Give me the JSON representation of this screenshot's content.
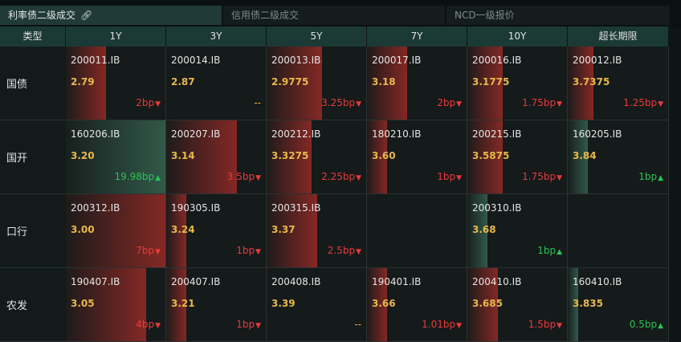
{
  "tabs": [
    {
      "label": "利率债二级成交",
      "active": true,
      "icon": "link-icon"
    },
    {
      "label": "信用债二级成交",
      "active": false
    },
    {
      "label": "NCD一级报价",
      "active": false
    }
  ],
  "header": {
    "type_label": "类型",
    "columns": [
      "1Y",
      "3Y",
      "5Y",
      "7Y",
      "10Y",
      "超长期限"
    ]
  },
  "colors": {
    "up": "#e93a3a",
    "down": "#29c553",
    "yield": "#e8b94a",
    "header_bg": "#1b3a36"
  },
  "rows": [
    {
      "label": "国债",
      "cells": [
        {
          "code": "200011.IB",
          "yield": "2.79",
          "change": "2bp",
          "dir": "up",
          "level": 0.4
        },
        {
          "code": "200014.IB",
          "yield": "2.87",
          "change": "--",
          "dir": "none",
          "level": 0
        },
        {
          "code": "200013.IB",
          "yield": "2.9775",
          "change": "3.25bp",
          "dir": "up",
          "level": 0.55
        },
        {
          "code": "200017.IB",
          "yield": "3.18",
          "change": "2bp",
          "dir": "up",
          "level": 0.4
        },
        {
          "code": "200016.IB",
          "yield": "3.1775",
          "change": "1.75bp",
          "dir": "up",
          "level": 0.35
        },
        {
          "code": "200012.IB",
          "yield": "3.7375",
          "change": "1.25bp",
          "dir": "up",
          "level": 0.25
        }
      ]
    },
    {
      "label": "国开",
      "cells": [
        {
          "code": "160206.IB",
          "yield": "3.20",
          "change": "19.98bp",
          "dir": "down",
          "level": 1.0
        },
        {
          "code": "200207.IB",
          "yield": "3.14",
          "change": "3.5bp",
          "dir": "up",
          "level": 0.7
        },
        {
          "code": "200212.IB",
          "yield": "3.3275",
          "change": "2.25bp",
          "dir": "up",
          "level": 0.45
        },
        {
          "code": "180210.IB",
          "yield": "3.60",
          "change": "1bp",
          "dir": "up",
          "level": 0.2
        },
        {
          "code": "200215.IB",
          "yield": "3.5875",
          "change": "1.75bp",
          "dir": "up",
          "level": 0.35
        },
        {
          "code": "160205.IB",
          "yield": "3.84",
          "change": "1bp",
          "dir": "down",
          "level": 0.2
        }
      ]
    },
    {
      "label": "口行",
      "cells": [
        {
          "code": "200312.IB",
          "yield": "3.00",
          "change": "7bp",
          "dir": "up",
          "level": 1.0
        },
        {
          "code": "190305.IB",
          "yield": "3.24",
          "change": "1bp",
          "dir": "up",
          "level": 0.2
        },
        {
          "code": "200315.IB",
          "yield": "3.37",
          "change": "2.5bp",
          "dir": "up",
          "level": 0.5
        },
        null,
        {
          "code": "200310.IB",
          "yield": "3.68",
          "change": "1bp",
          "dir": "down",
          "level": 0.2
        },
        null
      ]
    },
    {
      "label": "农发",
      "cells": [
        {
          "code": "190407.IB",
          "yield": "3.05",
          "change": "4bp",
          "dir": "up",
          "level": 0.8
        },
        {
          "code": "200407.IB",
          "yield": "3.21",
          "change": "1bp",
          "dir": "up",
          "level": 0.2
        },
        {
          "code": "200408.IB",
          "yield": "3.39",
          "change": "--",
          "dir": "none",
          "level": 0
        },
        {
          "code": "190401.IB",
          "yield": "3.66",
          "change": "1.01bp",
          "dir": "up",
          "level": 0.2
        },
        {
          "code": "200410.IB",
          "yield": "3.685",
          "change": "1.5bp",
          "dir": "up",
          "level": 0.3
        },
        {
          "code": "160410.IB",
          "yield": "3.835",
          "change": "0.5bp",
          "dir": "down",
          "level": 0.1
        }
      ]
    }
  ]
}
